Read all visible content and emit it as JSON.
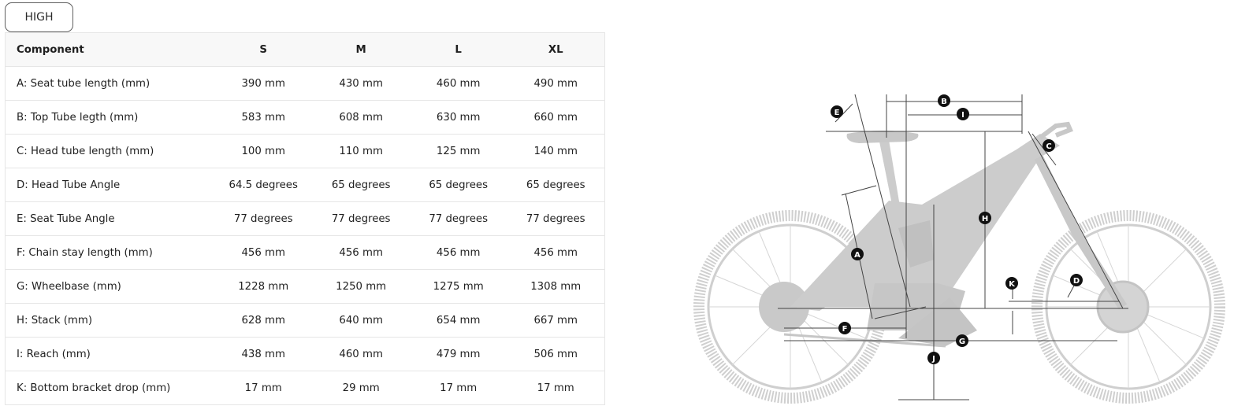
{
  "tab": {
    "label": "HIGH"
  },
  "table": {
    "headers": [
      "Component",
      "S",
      "M",
      "L",
      "XL"
    ],
    "rows": [
      [
        "A: Seat tube length (mm)",
        "390 mm",
        "430 mm",
        "460 mm",
        "490 mm"
      ],
      [
        "B: Top Tube legth (mm)",
        "583 mm",
        "608 mm",
        "630 mm",
        "660 mm"
      ],
      [
        "C: Head tube length (mm)",
        "100 mm",
        "110 mm",
        "125 mm",
        "140 mm"
      ],
      [
        "D: Head Tube Angle",
        "64.5 degrees",
        "65 degrees",
        "65 degrees",
        "65 degrees"
      ],
      [
        "E: Seat Tube Angle",
        "77 degrees",
        "77 degrees",
        "77 degrees",
        "77 degrees"
      ],
      [
        "F: Chain stay length (mm)",
        "456 mm",
        "456 mm",
        "456 mm",
        "456 mm"
      ],
      [
        "G: Wheelbase (mm)",
        "1228 mm",
        "1250 mm",
        "1275 mm",
        "1308 mm"
      ],
      [
        "H: Stack (mm)",
        "628 mm",
        "640 mm",
        "654 mm",
        "667 mm"
      ],
      [
        "I: Reach (mm)",
        "438 mm",
        "460 mm",
        "479 mm",
        "506 mm"
      ],
      [
        "K: Bottom bracket drop (mm)",
        "17 mm",
        "29 mm",
        "17 mm",
        "17 mm"
      ]
    ]
  },
  "diagram": {
    "markers": [
      "A",
      "B",
      "C",
      "D",
      "E",
      "F",
      "G",
      "H",
      "I",
      "J",
      "K"
    ],
    "colors": {
      "bike": "#cfcfcf",
      "lines": "#444444",
      "marker": "#111111"
    }
  }
}
